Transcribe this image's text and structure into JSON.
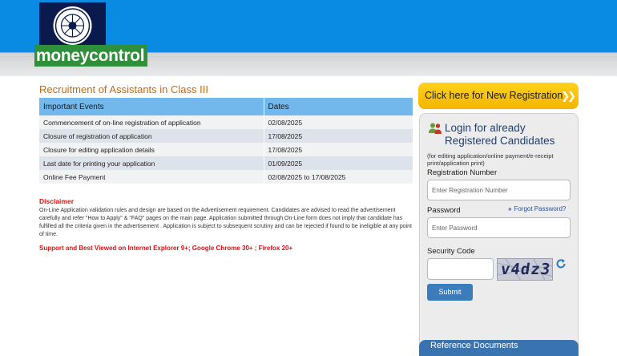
{
  "header": {
    "brand": "moneycontrol"
  },
  "main": {
    "title": "Recruitment of Assistants in Class III",
    "table": {
      "headers": [
        "Important Events",
        "Dates"
      ],
      "rows": [
        [
          "Commencement of on-line registration of application",
          "02/08/2025"
        ],
        [
          "Closure of registration of application",
          "17/08/2025"
        ],
        [
          "Closure for editing application details",
          "17/08/2025"
        ],
        [
          "Last date for printing your application",
          "01/09/2025"
        ],
        [
          "Online Fee Payment",
          "02/08/2025 to 17/08/2025"
        ]
      ]
    },
    "disclaimer_title": "Disclaimer",
    "disclaimer_text": "On-Line Application validation rules and design are based on the Advertisement requirement. Candidates are advised to read the advertisement carefully and refer \"How to Apply\" & \"FAQ\" pages on the main page. Application submitted through On-Line form does not imply that candidate has fulfilled all the criteria given in the advertisement . Application is subject to subsequent scrutiny and can be rejected if found to be ineligible at any point of time.",
    "support_text": "Support and Best Viewed on Internet Explorer 9+; Google Chrome 30+ ; Firefox 20+"
  },
  "sidebar": {
    "new_registration_label": "Click here for New Registration",
    "login_title": "Login for already Registered Candidates",
    "login_note": "(for editing application/online payment/e-receipt print/application print)",
    "registration_number_label": "Registration Number",
    "registration_number_placeholder": "Enter Registration Number",
    "password_label": "Password",
    "password_placeholder": "Enter Password",
    "forgot_password_label": "Forgot Password?",
    "security_code_label": "Security Code",
    "captcha_text": "v4dz3",
    "submit_label": "Submit",
    "reference_documents_label": "Reference Documents"
  },
  "colors": {
    "header_blue": "#0a8be3",
    "brand_green": "#2f8f3a",
    "title_orange": "#c46a14",
    "table_header_blue": "#72b8ec",
    "disclaimer_red": "#dd1111",
    "cta_yellow": "#f5b400",
    "login_title_blue": "#1f3f73",
    "submit_blue": "#3a7cbc"
  },
  "icons": [
    "emblem-logo",
    "users-icon",
    "double-chevron-icon",
    "refresh-icon"
  ]
}
